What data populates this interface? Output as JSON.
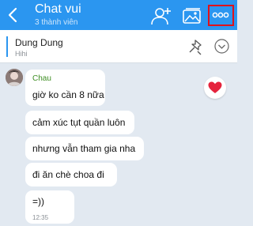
{
  "header": {
    "title": "Chat vui",
    "subtitle": "3 thành viên"
  },
  "pinned": {
    "name": "Dung Dung",
    "message": "Hihi"
  },
  "messages": {
    "sender": "Chau",
    "items": [
      "giờ ko cần 8 nữa",
      "cảm xúc tụt quần luôn",
      "nhưng vẫn tham gia nha",
      "đi ăn chè choa đi",
      "=))"
    ],
    "time": "12:35"
  },
  "colors": {
    "header_bg": "#2b96f0",
    "chat_bg": "#e2e9f1",
    "sender_name": "#3e8e23",
    "highlight": "#e0121a",
    "reaction_heart": "#e5233d"
  },
  "icons": [
    "back-icon",
    "add-member-icon",
    "gallery-icon",
    "more-icon",
    "pin-icon",
    "chevron-down-icon",
    "heart-icon"
  ]
}
